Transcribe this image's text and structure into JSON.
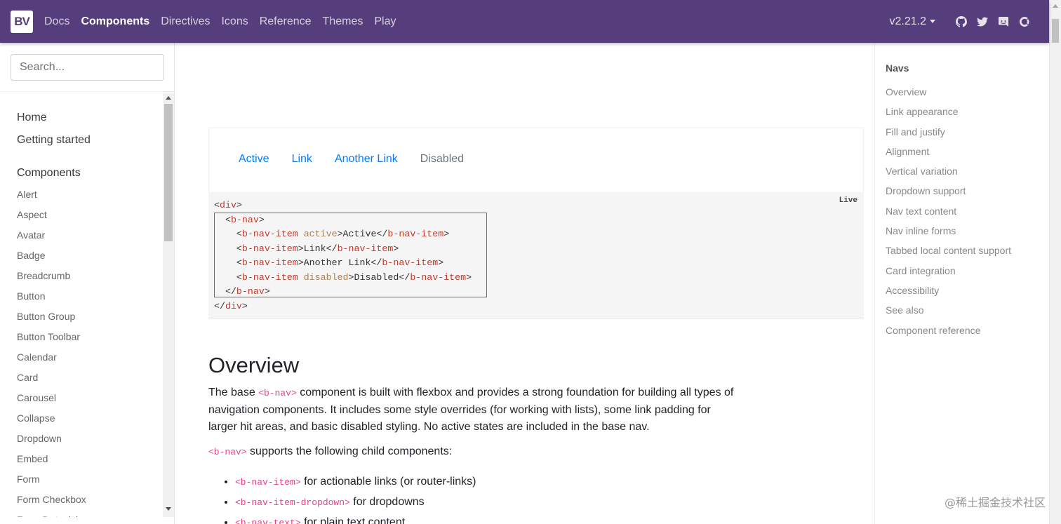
{
  "navbar": {
    "brand": "BV",
    "links": [
      {
        "label": "Docs",
        "active": false
      },
      {
        "label": "Components",
        "active": true
      },
      {
        "label": "Directives",
        "active": false
      },
      {
        "label": "Icons",
        "active": false
      },
      {
        "label": "Reference",
        "active": false
      },
      {
        "label": "Themes",
        "active": false
      },
      {
        "label": "Play",
        "active": false
      }
    ],
    "version": "v2.21.2",
    "bg_color": "#563d7c"
  },
  "search": {
    "placeholder": "Search..."
  },
  "sidebar": {
    "top_links": [
      "Home",
      "Getting started"
    ],
    "section_title": "Components",
    "items": [
      "Alert",
      "Aspect",
      "Avatar",
      "Badge",
      "Breadcrumb",
      "Button",
      "Button Group",
      "Button Toolbar",
      "Calendar",
      "Card",
      "Carousel",
      "Collapse",
      "Dropdown",
      "Embed",
      "Form",
      "Form Checkbox",
      "Form Datepicker"
    ]
  },
  "example": {
    "nav_items": [
      {
        "label": "Active",
        "disabled": false
      },
      {
        "label": "Link",
        "disabled": false
      },
      {
        "label": "Another Link",
        "disabled": false
      },
      {
        "label": "Disabled",
        "disabled": true
      }
    ],
    "live_label": "Live"
  },
  "overview": {
    "heading": "Overview",
    "p1_before": "The base ",
    "p1_code": "<b-nav>",
    "p1_after": " component is built with flexbox and provides a strong foundation for building all types of navigation components. It includes some style overrides (for working with lists), some link padding for larger hit areas, and basic disabled styling. No active states are included in the base nav.",
    "p2_code": "<b-nav>",
    "p2_after": " supports the following child components:",
    "children": [
      {
        "code": "<b-nav-item>",
        "text": " for actionable links (or router-links)"
      },
      {
        "code": "<b-nav-item-dropdown>",
        "text": " for dropdowns"
      },
      {
        "code": "<b-nav-text>",
        "text": " for plain text content"
      }
    ]
  },
  "toc": {
    "heading": "Navs",
    "items": [
      "Overview",
      "Link appearance",
      "Fill and justify",
      "Alignment",
      "Vertical variation",
      "Dropdown support",
      "Nav text content",
      "Nav inline forms",
      "Tabbed local content support",
      "Card integration",
      "Accessibility",
      "See also",
      "Component reference"
    ]
  },
  "watermark": "@稀土掘金技术社区"
}
